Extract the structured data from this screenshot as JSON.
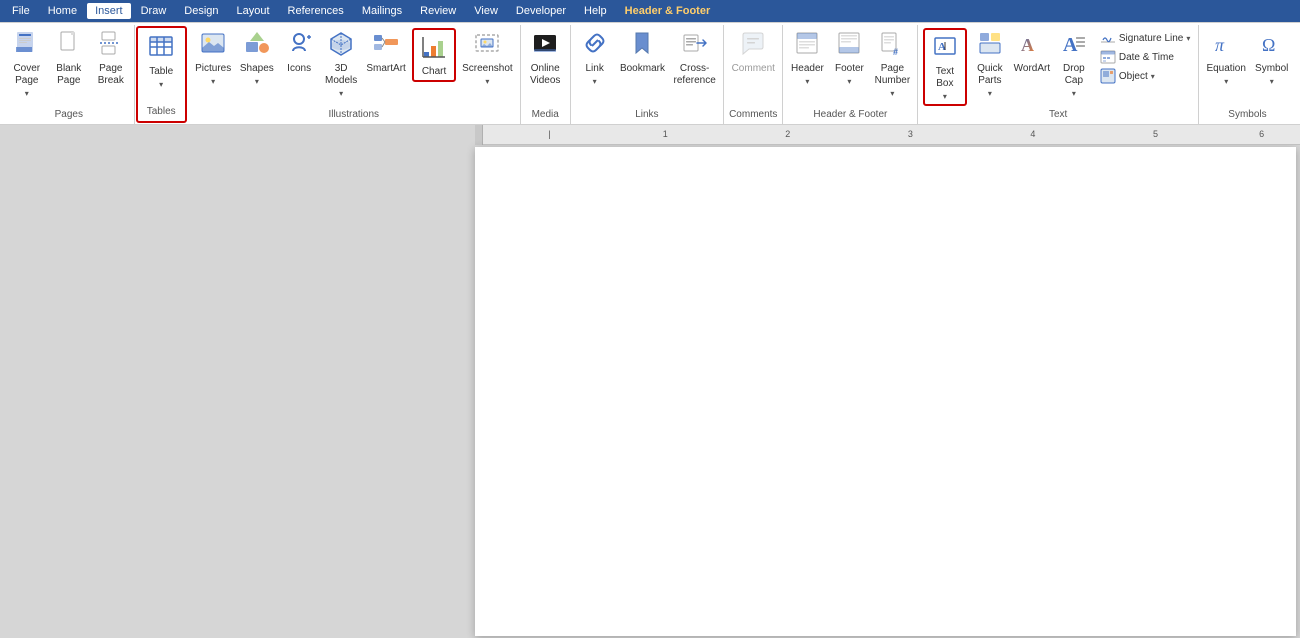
{
  "menubar": {
    "items": [
      {
        "label": "File",
        "active": false
      },
      {
        "label": "Home",
        "active": false
      },
      {
        "label": "Insert",
        "active": true,
        "highlighted": false
      },
      {
        "label": "Draw",
        "active": false
      },
      {
        "label": "Design",
        "active": false
      },
      {
        "label": "Layout",
        "active": false
      },
      {
        "label": "References",
        "active": false
      },
      {
        "label": "Mailings",
        "active": false
      },
      {
        "label": "Review",
        "active": false
      },
      {
        "label": "View",
        "active": false
      },
      {
        "label": "Developer",
        "active": false
      },
      {
        "label": "Help",
        "active": false
      },
      {
        "label": "Header & Footer",
        "active": false,
        "highlighted": true
      }
    ]
  },
  "ribbon": {
    "groups": [
      {
        "name": "Pages",
        "label": "Pages",
        "items": [
          {
            "label": "Cover\nPage",
            "has_dropdown": true,
            "icon": "cover"
          },
          {
            "label": "Blank\nPage",
            "has_dropdown": false,
            "icon": "blank"
          },
          {
            "label": "Page\nBreak",
            "has_dropdown": false,
            "icon": "pagebreak"
          }
        ]
      },
      {
        "name": "Tables",
        "label": "Tables",
        "highlighted": true,
        "items": [
          {
            "label": "Table",
            "has_dropdown": true,
            "icon": "table"
          }
        ]
      },
      {
        "name": "Illustrations",
        "label": "Illustrations",
        "items": [
          {
            "label": "Pictures",
            "has_dropdown": true,
            "icon": "pictures"
          },
          {
            "label": "Shapes",
            "has_dropdown": true,
            "icon": "shapes"
          },
          {
            "label": "Icons",
            "has_dropdown": false,
            "icon": "icons"
          },
          {
            "label": "3D\nModels",
            "has_dropdown": true,
            "icon": "3dmodels"
          },
          {
            "label": "SmartArt",
            "has_dropdown": false,
            "icon": "smartart"
          },
          {
            "label": "Chart",
            "has_dropdown": false,
            "icon": "chart",
            "highlighted": true
          },
          {
            "label": "Screenshot",
            "has_dropdown": true,
            "icon": "screenshot"
          }
        ]
      },
      {
        "name": "Media",
        "label": "Media",
        "items": [
          {
            "label": "Online\nVideos",
            "has_dropdown": false,
            "icon": "onlinevideos"
          }
        ]
      },
      {
        "name": "Links",
        "label": "Links",
        "items": [
          {
            "label": "Link",
            "has_dropdown": true,
            "icon": "link"
          },
          {
            "label": "Bookmark",
            "has_dropdown": false,
            "icon": "bookmark"
          },
          {
            "label": "Cross-\nreference",
            "has_dropdown": false,
            "icon": "crossref"
          }
        ]
      },
      {
        "name": "Comments",
        "label": "Comments",
        "items": [
          {
            "label": "Comment",
            "has_dropdown": false,
            "icon": "comment",
            "disabled": true
          }
        ]
      },
      {
        "name": "Header & Footer",
        "label": "Header & Footer",
        "items": [
          {
            "label": "Header",
            "has_dropdown": true,
            "icon": "header"
          },
          {
            "label": "Footer",
            "has_dropdown": true,
            "icon": "footer"
          },
          {
            "label": "Page\nNumber",
            "has_dropdown": true,
            "icon": "pagenumber"
          }
        ]
      },
      {
        "name": "Text",
        "label": "Text",
        "items_large": [
          {
            "label": "Text\nBox",
            "has_dropdown": true,
            "icon": "textbox",
            "highlighted": true
          },
          {
            "label": "Quick\nParts",
            "has_dropdown": true,
            "icon": "quickparts"
          },
          {
            "label": "WordArt",
            "has_dropdown": false,
            "icon": "wordart"
          },
          {
            "label": "Drop\nCap",
            "has_dropdown": true,
            "icon": "dropcap"
          }
        ],
        "items_small": [
          {
            "label": "Signature Line",
            "has_dropdown": true,
            "icon": "sigline"
          },
          {
            "label": "Date & Time",
            "has_dropdown": false,
            "icon": "datetime"
          },
          {
            "label": "Object",
            "has_dropdown": true,
            "icon": "object"
          }
        ]
      },
      {
        "name": "Symbols",
        "label": "Symbols",
        "items": [
          {
            "label": "Equation",
            "has_dropdown": true,
            "icon": "equation"
          },
          {
            "label": "Symbol",
            "has_dropdown": true,
            "icon": "symbol"
          }
        ]
      }
    ]
  },
  "document": {
    "ruler_labels": [
      "1",
      "2",
      "3",
      "4",
      "5",
      "6"
    ]
  }
}
